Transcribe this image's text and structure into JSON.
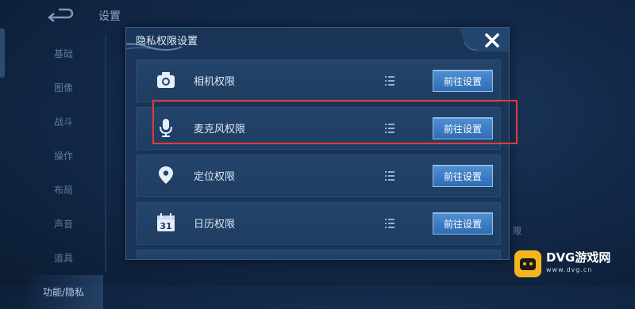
{
  "background": {
    "title": "设置",
    "menu": [
      "基础",
      "图像",
      "战斗",
      "操作",
      "布局",
      "声音",
      "道具",
      "功能/隐私"
    ],
    "active_index": 7,
    "right_fragment": "限"
  },
  "dialog": {
    "title": "隐私权限设置",
    "rows": [
      {
        "icon": "camera-icon",
        "label": "相机权限",
        "button": "前往设置"
      },
      {
        "icon": "microphone-icon",
        "label": "麦克风权限",
        "button": "前往设置"
      },
      {
        "icon": "location-pin-icon",
        "label": "定位权限",
        "button": "前往设置"
      },
      {
        "icon": "calendar-icon",
        "label": "日历权限",
        "button": "前往设置",
        "calendar_day": "31"
      }
    ]
  },
  "highlight_color": "#e23a3a",
  "accent": "#2f6db4",
  "watermark": {
    "brand": "DVG游戏网",
    "url": "www.dvg.cn"
  }
}
